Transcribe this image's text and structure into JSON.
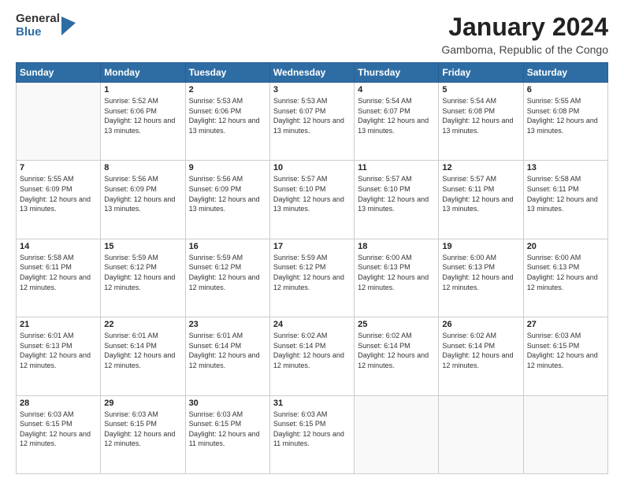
{
  "logo": {
    "general": "General",
    "blue": "Blue"
  },
  "header": {
    "title": "January 2024",
    "subtitle": "Gamboma, Republic of the Congo"
  },
  "days_of_week": [
    "Sunday",
    "Monday",
    "Tuesday",
    "Wednesday",
    "Thursday",
    "Friday",
    "Saturday"
  ],
  "weeks": [
    [
      {
        "num": "",
        "sunrise": "",
        "sunset": "",
        "daylight": ""
      },
      {
        "num": "1",
        "sunrise": "Sunrise: 5:52 AM",
        "sunset": "Sunset: 6:06 PM",
        "daylight": "Daylight: 12 hours and 13 minutes."
      },
      {
        "num": "2",
        "sunrise": "Sunrise: 5:53 AM",
        "sunset": "Sunset: 6:06 PM",
        "daylight": "Daylight: 12 hours and 13 minutes."
      },
      {
        "num": "3",
        "sunrise": "Sunrise: 5:53 AM",
        "sunset": "Sunset: 6:07 PM",
        "daylight": "Daylight: 12 hours and 13 minutes."
      },
      {
        "num": "4",
        "sunrise": "Sunrise: 5:54 AM",
        "sunset": "Sunset: 6:07 PM",
        "daylight": "Daylight: 12 hours and 13 minutes."
      },
      {
        "num": "5",
        "sunrise": "Sunrise: 5:54 AM",
        "sunset": "Sunset: 6:08 PM",
        "daylight": "Daylight: 12 hours and 13 minutes."
      },
      {
        "num": "6",
        "sunrise": "Sunrise: 5:55 AM",
        "sunset": "Sunset: 6:08 PM",
        "daylight": "Daylight: 12 hours and 13 minutes."
      }
    ],
    [
      {
        "num": "7",
        "sunrise": "Sunrise: 5:55 AM",
        "sunset": "Sunset: 6:09 PM",
        "daylight": "Daylight: 12 hours and 13 minutes."
      },
      {
        "num": "8",
        "sunrise": "Sunrise: 5:56 AM",
        "sunset": "Sunset: 6:09 PM",
        "daylight": "Daylight: 12 hours and 13 minutes."
      },
      {
        "num": "9",
        "sunrise": "Sunrise: 5:56 AM",
        "sunset": "Sunset: 6:09 PM",
        "daylight": "Daylight: 12 hours and 13 minutes."
      },
      {
        "num": "10",
        "sunrise": "Sunrise: 5:57 AM",
        "sunset": "Sunset: 6:10 PM",
        "daylight": "Daylight: 12 hours and 13 minutes."
      },
      {
        "num": "11",
        "sunrise": "Sunrise: 5:57 AM",
        "sunset": "Sunset: 6:10 PM",
        "daylight": "Daylight: 12 hours and 13 minutes."
      },
      {
        "num": "12",
        "sunrise": "Sunrise: 5:57 AM",
        "sunset": "Sunset: 6:11 PM",
        "daylight": "Daylight: 12 hours and 13 minutes."
      },
      {
        "num": "13",
        "sunrise": "Sunrise: 5:58 AM",
        "sunset": "Sunset: 6:11 PM",
        "daylight": "Daylight: 12 hours and 13 minutes."
      }
    ],
    [
      {
        "num": "14",
        "sunrise": "Sunrise: 5:58 AM",
        "sunset": "Sunset: 6:11 PM",
        "daylight": "Daylight: 12 hours and 12 minutes."
      },
      {
        "num": "15",
        "sunrise": "Sunrise: 5:59 AM",
        "sunset": "Sunset: 6:12 PM",
        "daylight": "Daylight: 12 hours and 12 minutes."
      },
      {
        "num": "16",
        "sunrise": "Sunrise: 5:59 AM",
        "sunset": "Sunset: 6:12 PM",
        "daylight": "Daylight: 12 hours and 12 minutes."
      },
      {
        "num": "17",
        "sunrise": "Sunrise: 5:59 AM",
        "sunset": "Sunset: 6:12 PM",
        "daylight": "Daylight: 12 hours and 12 minutes."
      },
      {
        "num": "18",
        "sunrise": "Sunrise: 6:00 AM",
        "sunset": "Sunset: 6:13 PM",
        "daylight": "Daylight: 12 hours and 12 minutes."
      },
      {
        "num": "19",
        "sunrise": "Sunrise: 6:00 AM",
        "sunset": "Sunset: 6:13 PM",
        "daylight": "Daylight: 12 hours and 12 minutes."
      },
      {
        "num": "20",
        "sunrise": "Sunrise: 6:00 AM",
        "sunset": "Sunset: 6:13 PM",
        "daylight": "Daylight: 12 hours and 12 minutes."
      }
    ],
    [
      {
        "num": "21",
        "sunrise": "Sunrise: 6:01 AM",
        "sunset": "Sunset: 6:13 PM",
        "daylight": "Daylight: 12 hours and 12 minutes."
      },
      {
        "num": "22",
        "sunrise": "Sunrise: 6:01 AM",
        "sunset": "Sunset: 6:14 PM",
        "daylight": "Daylight: 12 hours and 12 minutes."
      },
      {
        "num": "23",
        "sunrise": "Sunrise: 6:01 AM",
        "sunset": "Sunset: 6:14 PM",
        "daylight": "Daylight: 12 hours and 12 minutes."
      },
      {
        "num": "24",
        "sunrise": "Sunrise: 6:02 AM",
        "sunset": "Sunset: 6:14 PM",
        "daylight": "Daylight: 12 hours and 12 minutes."
      },
      {
        "num": "25",
        "sunrise": "Sunrise: 6:02 AM",
        "sunset": "Sunset: 6:14 PM",
        "daylight": "Daylight: 12 hours and 12 minutes."
      },
      {
        "num": "26",
        "sunrise": "Sunrise: 6:02 AM",
        "sunset": "Sunset: 6:14 PM",
        "daylight": "Daylight: 12 hours and 12 minutes."
      },
      {
        "num": "27",
        "sunrise": "Sunrise: 6:03 AM",
        "sunset": "Sunset: 6:15 PM",
        "daylight": "Daylight: 12 hours and 12 minutes."
      }
    ],
    [
      {
        "num": "28",
        "sunrise": "Sunrise: 6:03 AM",
        "sunset": "Sunset: 6:15 PM",
        "daylight": "Daylight: 12 hours and 12 minutes."
      },
      {
        "num": "29",
        "sunrise": "Sunrise: 6:03 AM",
        "sunset": "Sunset: 6:15 PM",
        "daylight": "Daylight: 12 hours and 12 minutes."
      },
      {
        "num": "30",
        "sunrise": "Sunrise: 6:03 AM",
        "sunset": "Sunset: 6:15 PM",
        "daylight": "Daylight: 12 hours and 11 minutes."
      },
      {
        "num": "31",
        "sunrise": "Sunrise: 6:03 AM",
        "sunset": "Sunset: 6:15 PM",
        "daylight": "Daylight: 12 hours and 11 minutes."
      },
      {
        "num": "",
        "sunrise": "",
        "sunset": "",
        "daylight": ""
      },
      {
        "num": "",
        "sunrise": "",
        "sunset": "",
        "daylight": ""
      },
      {
        "num": "",
        "sunrise": "",
        "sunset": "",
        "daylight": ""
      }
    ]
  ]
}
